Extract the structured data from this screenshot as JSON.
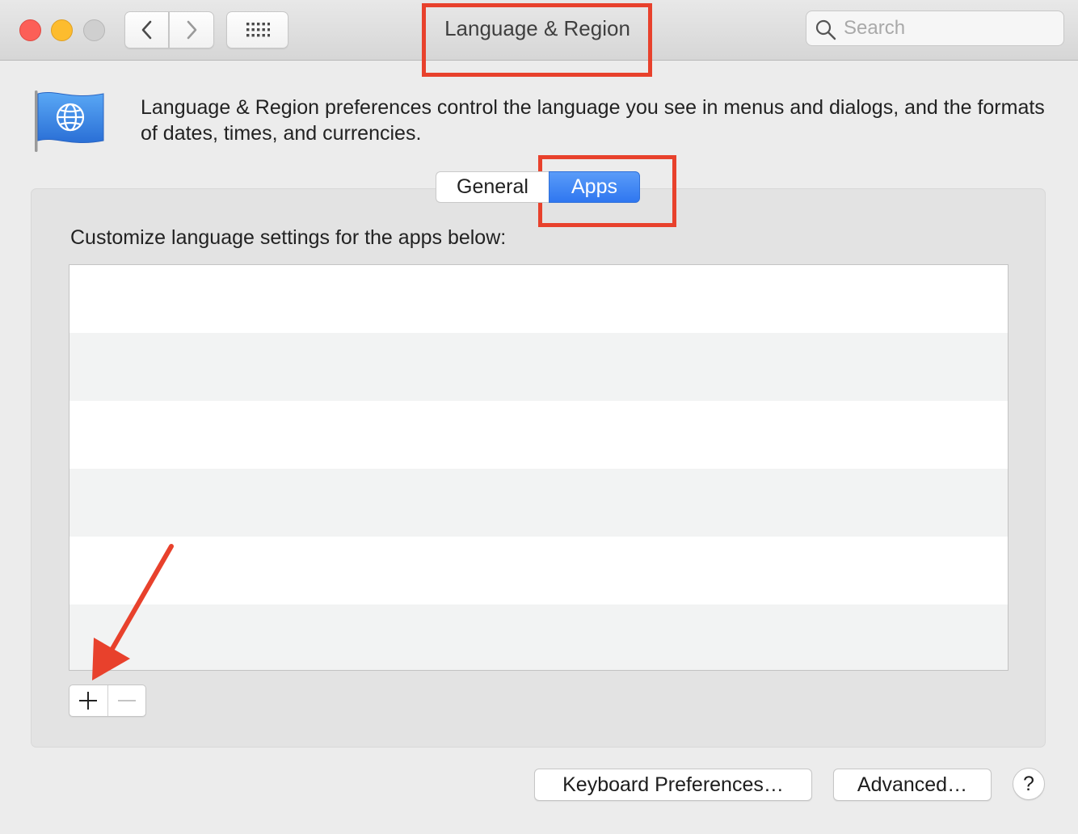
{
  "window": {
    "title": "Language & Region",
    "traffic_lights": {
      "close": "#fc5f57",
      "minimize": "#fdbc2e",
      "zoom": "#cfcfcf"
    }
  },
  "toolbar": {
    "back_icon": "chevron-left-icon",
    "forward_icon": "chevron-right-icon",
    "grid_icon": "show-all-grid-icon",
    "search": {
      "placeholder": "Search",
      "value": ""
    }
  },
  "header": {
    "icon": "globe-flag-icon",
    "description": "Language & Region preferences control the language you see in menus and dialogs, and the formats of dates, times, and currencies."
  },
  "tabs": [
    {
      "label": "General",
      "selected": false
    },
    {
      "label": "Apps",
      "selected": true
    }
  ],
  "apps_panel": {
    "label": "Customize language settings for the apps below:",
    "rows": [],
    "add_icon": "plus-icon",
    "remove_icon": "minus-icon"
  },
  "footer": {
    "keyboard_label": "Keyboard Preferences…",
    "advanced_label": "Advanced…",
    "help_label": "?"
  },
  "annotations": {
    "color": "#e8412c"
  },
  "colors": {
    "accent": "#2f77f0",
    "window_bg": "#ececec",
    "row_alt": "#f2f3f3"
  }
}
